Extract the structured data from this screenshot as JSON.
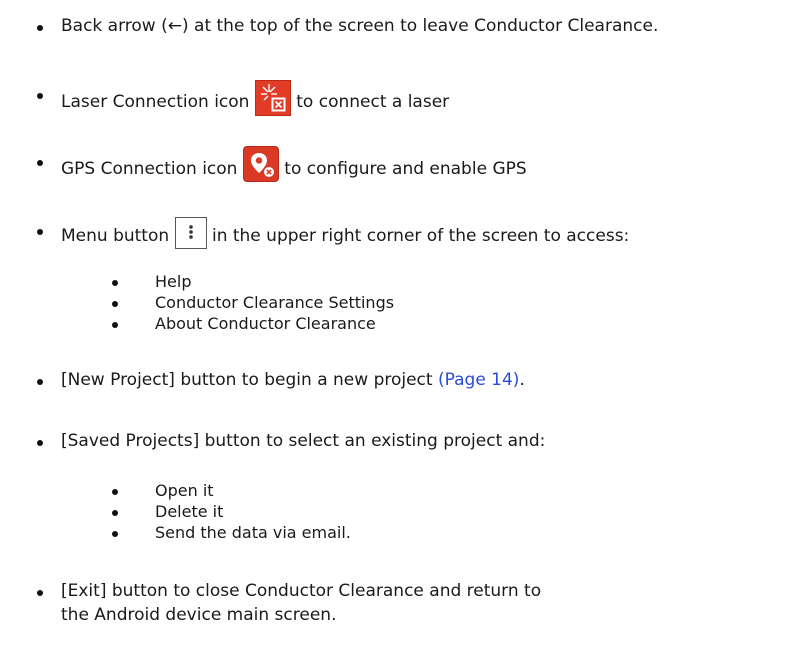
{
  "items": [
    {
      "text": "Back arrow (←) at the top of the screen to leave Conductor Clearance."
    },
    {
      "before": "Laser Connection icon ",
      "after": " to connect a laser",
      "icon": "laser-connection-icon"
    },
    {
      "before": "GPS Connection icon ",
      "after": " to configure and enable GPS",
      "icon": "gps-connection-icon"
    },
    {
      "before": "Menu button ",
      "after": " in the upper right corner of the screen to access:",
      "icon": "menu-kebab-icon",
      "subitems": [
        "Help",
        "Conductor Clearance Settings",
        "About Conductor Clearance"
      ]
    },
    {
      "before": "[New Project] button to begin a new project ",
      "link": "(Page 14)",
      "after": "."
    },
    {
      "text": "[Saved Projects] button to select an existing project and:",
      "subitems": [
        "Open it",
        "Delete it",
        "Send the data via email."
      ]
    },
    {
      "line1": "[Exit] button to close Conductor Clearance and return to",
      "line2": "the Android device main screen."
    }
  ],
  "colors": {
    "link": "#2a4bd7",
    "icon_red": "#e23b26",
    "text": "#1a1a1a"
  }
}
